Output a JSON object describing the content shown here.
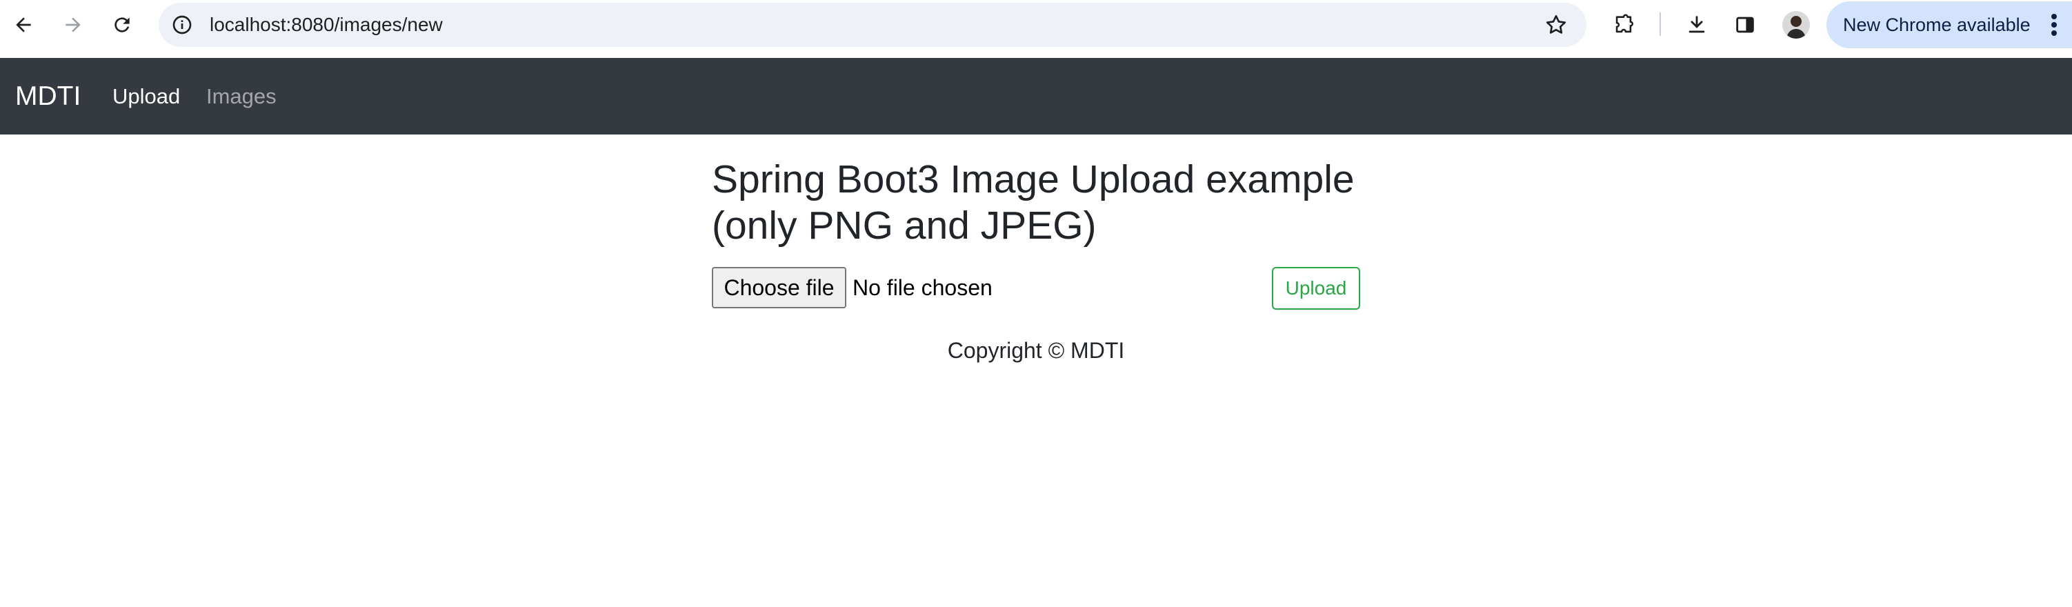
{
  "browser": {
    "url": "localhost:8080/images/new",
    "update_label": "New Chrome available",
    "icons": {
      "back": "back-arrow-icon",
      "forward": "forward-arrow-icon",
      "reload": "reload-icon",
      "site_info": "info-icon",
      "bookmark": "star-icon",
      "extensions": "puzzle-icon",
      "downloads": "download-icon",
      "side_panel": "side-panel-icon",
      "menu": "kebab-menu-icon"
    },
    "colors": {
      "omnibox_bg": "#eef1f8",
      "update_pill_bg": "#d3e3fd"
    }
  },
  "navbar": {
    "brand": "MDTI",
    "links": [
      {
        "label": "Upload",
        "active": true
      },
      {
        "label": "Images",
        "active": false
      }
    ],
    "colors": {
      "background": "#343a40"
    }
  },
  "main": {
    "title_line1": "Spring Boot3 Image Upload example",
    "title_line2": "(only PNG and JPEG)",
    "file_button": "Choose file",
    "file_status": "No file chosen",
    "upload_button": "Upload",
    "colors": {
      "upload_accent": "#28a745"
    }
  },
  "footer": {
    "text": "Copyright © MDTI"
  }
}
